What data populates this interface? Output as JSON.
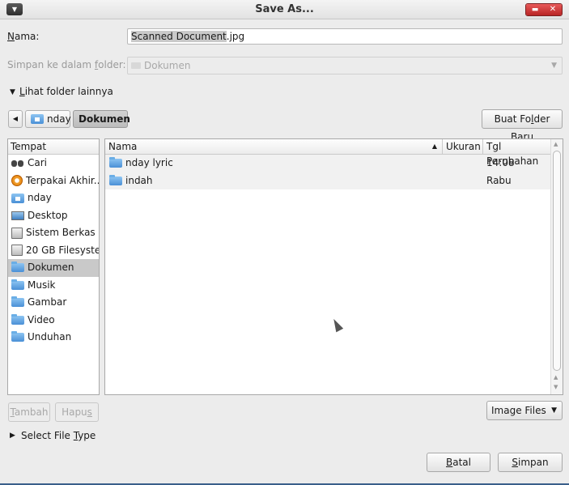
{
  "window": {
    "title": "Save As..."
  },
  "name_field": {
    "label_pre": "",
    "label_u": "N",
    "label_post": "ama:",
    "value_selected": "Scanned Document",
    "value_rest": ".jpg"
  },
  "save_in": {
    "label_pre": "Simpan ke dalam ",
    "label_u": "f",
    "label_post": "older:",
    "value": "Dokumen"
  },
  "browse": {
    "label_pre": "",
    "label_u": "L",
    "label_post": "ihat folder lainnya"
  },
  "pathbar": {
    "items": [
      "nday",
      "Dokumen"
    ]
  },
  "create_folder": {
    "label_pre": "Buat Fo",
    "label_u": "l",
    "label_post": "der Baru"
  },
  "places": {
    "header": "Tempat",
    "items": [
      {
        "label": "Cari",
        "icon": "search-icon"
      },
      {
        "label": "Terpakai Akhir...",
        "icon": "recent-icon"
      },
      {
        "label": "nday",
        "icon": "home-icon"
      },
      {
        "label": "Desktop",
        "icon": "desktop-icon"
      },
      {
        "label": "Sistem Berkas",
        "icon": "drive-icon"
      },
      {
        "label": "20 GB Filesyste...",
        "icon": "drive-icon"
      },
      {
        "label": "Dokumen",
        "icon": "folder-icon"
      },
      {
        "label": "Musik",
        "icon": "folder-icon"
      },
      {
        "label": "Gambar",
        "icon": "folder-icon"
      },
      {
        "label": "Video",
        "icon": "folder-icon"
      },
      {
        "label": "Unduhan",
        "icon": "folder-icon"
      }
    ]
  },
  "files": {
    "headers": {
      "name": "Nama",
      "size": "Ukuran",
      "modified": "Tgl Perubahan"
    },
    "rows": [
      {
        "name": "nday lyric",
        "size": "",
        "modified": "14:08"
      },
      {
        "name": "indah",
        "size": "",
        "modified": "Rabu"
      }
    ]
  },
  "add_button": {
    "label_pre": "",
    "label_u": "T",
    "label_post": "ambah"
  },
  "remove_button": {
    "label_pre": "Hapu",
    "label_u": "s",
    "label_post": ""
  },
  "filter": {
    "value": "Image Files"
  },
  "file_type": {
    "label_pre": "Select File ",
    "label_u": "T",
    "label_post": "ype"
  },
  "cancel_button": {
    "label_pre": "",
    "label_u": "B",
    "label_post": "atal"
  },
  "save_button": {
    "label_pre": "",
    "label_u": "S",
    "label_post": "impan"
  },
  "colors": {
    "title_close": "#c83030",
    "selection": "#c9c9c9",
    "folder": "#4a90d6"
  }
}
